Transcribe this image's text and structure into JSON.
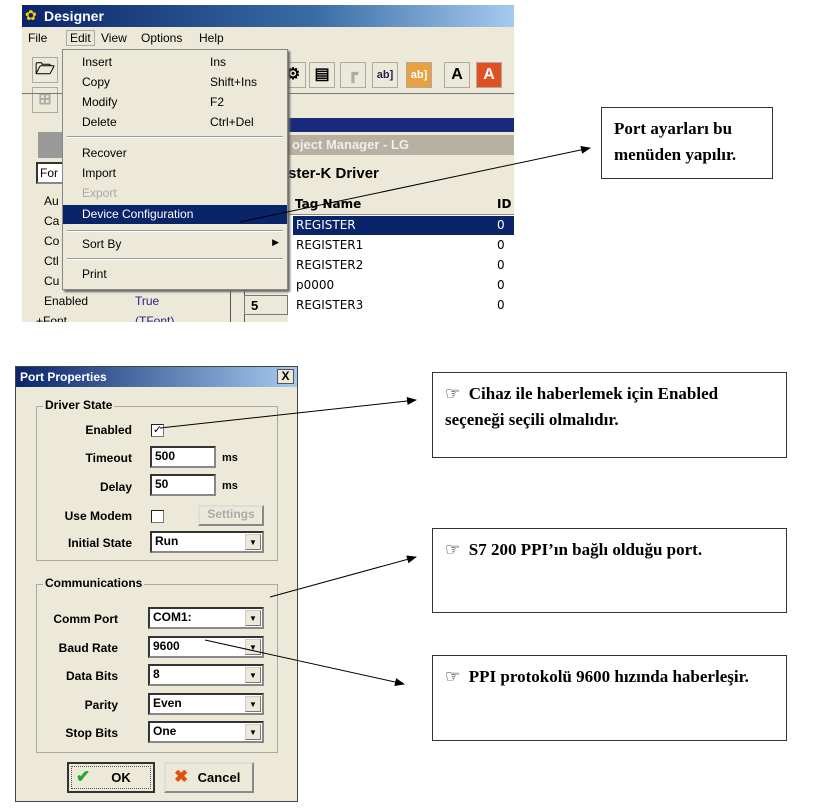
{
  "designer": {
    "title": "Designer",
    "menubar": [
      "File",
      "Edit",
      "View",
      "Options",
      "Help"
    ],
    "edit_menu": [
      {
        "label": "Insert",
        "shortcut": "Ins"
      },
      {
        "label": "Copy",
        "shortcut": "Shift+Ins"
      },
      {
        "label": "Modify",
        "shortcut": "F2"
      },
      {
        "label": "Delete",
        "shortcut": "Ctrl+Del"
      },
      {
        "label": "Recover"
      },
      {
        "label": "Import"
      },
      {
        "label": "Export",
        "disabled": true
      },
      {
        "label": "Device Configuration",
        "highlighted": true
      },
      {
        "label": "Sort By",
        "submenu": true
      },
      {
        "label": "Print"
      }
    ],
    "toolbar_text": [
      "ab]",
      "ab]",
      "A",
      "A"
    ],
    "project_manager_title": "oject Manager - LG",
    "driver_title": "ster-K Driver",
    "table": {
      "headers": [
        "Tag Name",
        "ID"
      ],
      "rows": [
        [
          "REGISTER",
          "0"
        ],
        [
          "REGISTER1",
          "0"
        ],
        [
          "REGISTER2",
          "0"
        ],
        [
          "p0000",
          "0"
        ],
        [
          "REGISTER3",
          "0"
        ]
      ],
      "row_number": "5"
    },
    "props": {
      "combo": "For",
      "rows": [
        "Au",
        "Ca",
        "Co",
        "Ctl",
        "Cu"
      ],
      "enabled_label": "Enabled",
      "enabled_value": "True",
      "font_label": "+Font",
      "font_value": "(TFont)"
    }
  },
  "port": {
    "title": "Port Properties",
    "close": "X",
    "driver_state": {
      "label": "Driver State",
      "enabled_label": "Enabled",
      "enabled_checked": true,
      "timeout_label": "Timeout",
      "timeout": "500",
      "delay_label": "Delay",
      "delay": "50",
      "unit": "ms",
      "use_modem_label": "Use Modem",
      "use_modem_checked": false,
      "settings": "Settings",
      "initial_state_label": "Initial State",
      "initial_state": "Run"
    },
    "communications": {
      "label": "Communications",
      "fields": [
        {
          "label": "Comm Port",
          "value": "COM1:"
        },
        {
          "label": "Baud Rate",
          "value": "9600"
        },
        {
          "label": "Data Bits",
          "value": "8"
        },
        {
          "label": "Parity",
          "value": "Even"
        },
        {
          "label": "Stop Bits",
          "value": "One"
        }
      ]
    },
    "ok": "OK",
    "cancel": "Cancel"
  },
  "callouts": [
    "Port ayarları bu menüden yapılır.",
    "Cihaz ile haberlemek için Enabled seçeneği seçili olmalıdır.",
    "S7 200 PPI’ın bağlı olduğu port.",
    "PPI protokolü 9600 hızında haberleşir."
  ],
  "colors": {
    "highlight": "#0a246a",
    "dialog_bg": "#ece9d8"
  }
}
